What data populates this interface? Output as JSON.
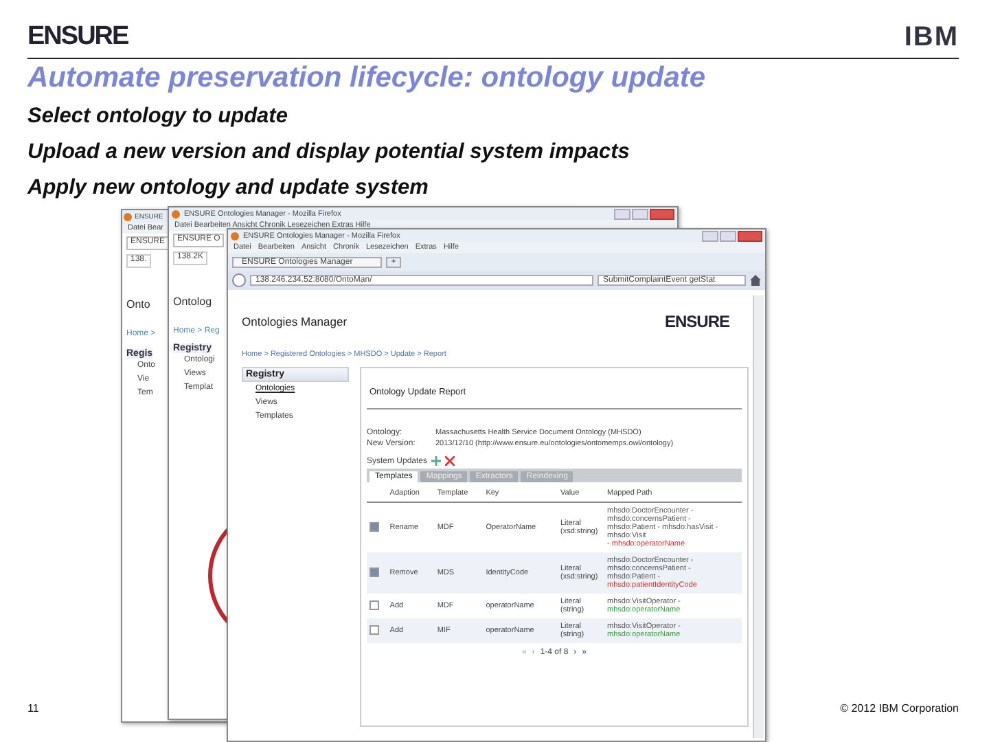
{
  "slide": {
    "logo": "ENSURE",
    "ibm_logo": "IBM",
    "title": "Automate preservation lifecycle: ontology update",
    "bullets": [
      "Select ontology to update",
      "Upload a new version and display potential system impacts",
      "Apply new ontology and update system"
    ],
    "page_number": "11",
    "copyright": "© 2012 IBM Corporation"
  },
  "back_windows": [
    {
      "title": "ENSURE",
      "menu": "Datei Bear",
      "tab": "ENSURE",
      "address": "138.",
      "heading": "Onto",
      "breadcrumb": "Home >",
      "sidebar_title": "Regis",
      "sidebar_items": [
        "Onto",
        "Vie",
        "Tem"
      ]
    },
    {
      "title": "ENSURE Ontologies Manager - Mozilla Firefox",
      "menu": "Datei Bearbeiten Ansicht Chronik Lesezeichen Extras Hilfe",
      "tab": "ENSURE O",
      "address": "138.2K",
      "heading": "Ontolog",
      "breadcrumb": "Home > Reg",
      "sidebar_title": "Registry",
      "sidebar_items": [
        "Ontologi",
        "Views",
        "Templat"
      ]
    }
  ],
  "window": {
    "title": "ENSURE Ontologies Manager - Mozilla Firefox",
    "menu": [
      "Datei",
      "Bearbeiten",
      "Ansicht",
      "Chronik",
      "Lesezeichen",
      "Extras",
      "Hilfe"
    ],
    "tab": "ENSURE Ontologies Manager",
    "new_tab": "+",
    "address": "138.246.234.52:8080/OntoMan/",
    "search": "SubmitComplaintEvent getStat",
    "page_title": "Ontologies Manager",
    "page_logo": "ENSURE",
    "breadcrumb": "Home > Registered Ontologies > MHSDO > Update > Report",
    "sidebar": {
      "title": "Registry",
      "items": [
        {
          "label": "Ontologies",
          "selected": true
        },
        {
          "label": "Views",
          "selected": false
        },
        {
          "label": "Templates",
          "selected": false
        }
      ]
    },
    "panel": {
      "title": "Ontology Update Report",
      "fields": [
        {
          "label": "Ontology:",
          "value": "Massachusetts Health Service Document Ontology (MHSDO)"
        },
        {
          "label": "New Version:",
          "value": "2013/12/10 (http://www.ensure.eu/ontologies/ontomemps.owl/ontology)"
        }
      ],
      "system_updates": "System Updates",
      "tabs": [
        {
          "label": "Templates",
          "selected": true
        },
        {
          "label": "Mappings",
          "selected": false
        },
        {
          "label": "Extractors",
          "selected": false
        },
        {
          "label": "Reindexing",
          "selected": false
        }
      ],
      "table": {
        "columns": [
          "Adaption",
          "Template",
          "Key",
          "Value",
          "Mapped Path"
        ],
        "rows": [
          {
            "checked": true,
            "adaption": "Rename",
            "template": "MDF",
            "key": "OperatorName",
            "value": "Literal (xsd:string)",
            "path": [
              {
                "text": "mhsdo:DoctorEncounter - mhsdo:concernsPatient - mhsdo:Patient - mhsdo:hasVisit - mhsdo:Visit",
                "kind": "plain"
              },
              {
                "text": "- mhsdo:operatorName",
                "kind": "removed"
              }
            ]
          },
          {
            "checked": true,
            "adaption": "Remove",
            "template": "MDS",
            "key": "IdentityCode",
            "value": "Literal (xsd:string)",
            "path": [
              {
                "text": "mhsdo:DoctorEncounter - mhsdo:concernsPatient - mhsdo:Patient -",
                "kind": "plain"
              },
              {
                "text": "mhsdo:patientIdentityCode",
                "kind": "removed"
              }
            ]
          },
          {
            "checked": false,
            "adaption": "Add",
            "template": "MDF",
            "key": "operatorName",
            "value": "Literal (string)",
            "path": [
              {
                "text": "mhsdo:VisitOperator -",
                "kind": "plain"
              },
              {
                "text": "mhsdo:operatorName",
                "kind": "added"
              }
            ]
          },
          {
            "checked": false,
            "adaption": "Add",
            "template": "MIF",
            "key": "operatorName",
            "value": "Literal (string)",
            "path": [
              {
                "text": "mhsdo:VisitOperator -",
                "kind": "plain"
              },
              {
                "text": "mhsdo:operatorName",
                "kind": "added"
              }
            ]
          }
        ]
      },
      "pager": {
        "first": "«",
        "previous": "‹",
        "label": "1-4 of 8",
        "next": "›",
        "last": "»"
      }
    }
  }
}
